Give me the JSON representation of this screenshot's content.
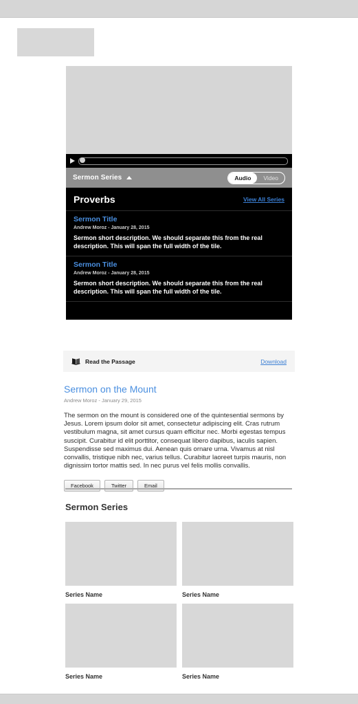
{
  "header": {
    "logo_placeholder": "logo-placeholder"
  },
  "player": {
    "play_label": "Play",
    "scrubber_label": "Playback position"
  },
  "series_bar": {
    "label": "Sermon Series",
    "collapse_icon": "chevron-up-icon",
    "toggle": {
      "options": [
        "Audio",
        "Video"
      ],
      "selected": "Audio"
    }
  },
  "panel": {
    "title": "Proverbs",
    "view_all": "View All Series",
    "sermons": [
      {
        "title": "Sermon Title",
        "meta": "Andrew Moroz - January 28, 2015",
        "description": "Sermon short description. We should separate this from the real description. This will span the full width of the tile."
      },
      {
        "title": "Sermon Title",
        "meta": "Andrew Moroz - January 28, 2015",
        "description": "Sermon short description. We should separate this from the real description. This will span the full width of the tile."
      }
    ]
  },
  "card_footer": {
    "read_passage": "Read the Passage",
    "read_passage_icon": "book-icon",
    "download": "Download"
  },
  "article": {
    "title": "Sermon on the Mount",
    "byline": "Andrew Moroz  - January 29, 2015",
    "body": "The sermon on the mount is considered one of the quintesential sermons by Jesus. Lorem ipsum dolor sit amet, consectetur adipiscing elit. Cras rutrum vestibulum magna, sit amet cursus quam efficitur nec. Morbi egestas tempus suscipit. Curabitur id elit porttitor, consequat libero dapibus, iaculis sapien. Suspendisse sed maximus dui. Aenean quis ornare urna. Vivamus at nisl convallis, tristique nibh nec, varius tellus. Curabitur laoreet turpis mauris, non dignissim tortor mattis sed. In nec purus vel felis mollis convallis.",
    "share_buttons": [
      "Facebook",
      "Twitter",
      "Email"
    ]
  },
  "series_grid": {
    "title": "Sermon Series",
    "tiles": [
      {
        "label": "Series Name"
      },
      {
        "label": "Series Name"
      },
      {
        "label": "Series Name"
      },
      {
        "label": "Series Name"
      }
    ]
  },
  "colors": {
    "link": "#3b7fd4",
    "panel_bg": "#000000",
    "series_bar_bg": "#8f8f8f",
    "placeholder": "#d8d8d8",
    "page_bg": "#d6d6d6"
  }
}
